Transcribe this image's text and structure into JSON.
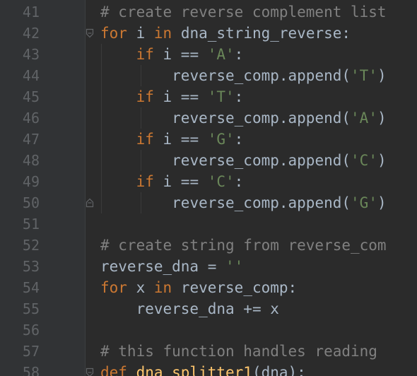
{
  "editor": {
    "colors": {
      "background": "#2b2b2b",
      "gutter": "#313335",
      "line_number": "#606366",
      "default_text": "#a9b7c6",
      "keyword": "#cc7832",
      "string": "#6a8759",
      "comment": "#808080"
    },
    "lines": [
      {
        "number": "41",
        "indent": "",
        "tokens": [
          {
            "t": "# create reverse complement list",
            "c": "comment"
          }
        ]
      },
      {
        "number": "42",
        "indent": "",
        "tokens": [
          {
            "t": "for",
            "c": "kw"
          },
          {
            "t": " i ",
            "c": "id"
          },
          {
            "t": "in",
            "c": "kw"
          },
          {
            "t": " dna_string_reverse:",
            "c": "id"
          }
        ]
      },
      {
        "number": "43",
        "indent": "    ",
        "tokens": [
          {
            "t": "if",
            "c": "kw"
          },
          {
            "t": " i == ",
            "c": "id"
          },
          {
            "t": "'A'",
            "c": "str"
          },
          {
            "t": ":",
            "c": "id"
          }
        ]
      },
      {
        "number": "44",
        "indent": "        ",
        "tokens": [
          {
            "t": "reverse_comp.append(",
            "c": "id"
          },
          {
            "t": "'T'",
            "c": "str"
          },
          {
            "t": ")",
            "c": "id"
          }
        ]
      },
      {
        "number": "45",
        "indent": "    ",
        "tokens": [
          {
            "t": "if",
            "c": "kw"
          },
          {
            "t": " i == ",
            "c": "id"
          },
          {
            "t": "'T'",
            "c": "str"
          },
          {
            "t": ":",
            "c": "id"
          }
        ]
      },
      {
        "number": "46",
        "indent": "        ",
        "tokens": [
          {
            "t": "reverse_comp.append(",
            "c": "id"
          },
          {
            "t": "'A'",
            "c": "str"
          },
          {
            "t": ")",
            "c": "id"
          }
        ]
      },
      {
        "number": "47",
        "indent": "    ",
        "tokens": [
          {
            "t": "if",
            "c": "kw"
          },
          {
            "t": " i == ",
            "c": "id"
          },
          {
            "t": "'G'",
            "c": "str"
          },
          {
            "t": ":",
            "c": "id"
          }
        ]
      },
      {
        "number": "48",
        "indent": "        ",
        "tokens": [
          {
            "t": "reverse_comp.append(",
            "c": "id"
          },
          {
            "t": "'C'",
            "c": "str"
          },
          {
            "t": ")",
            "c": "id"
          }
        ]
      },
      {
        "number": "49",
        "indent": "    ",
        "tokens": [
          {
            "t": "if",
            "c": "kw"
          },
          {
            "t": " i == ",
            "c": "id"
          },
          {
            "t": "'C'",
            "c": "str"
          },
          {
            "t": ":",
            "c": "id"
          }
        ]
      },
      {
        "number": "50",
        "indent": "        ",
        "tokens": [
          {
            "t": "reverse_comp.append(",
            "c": "id"
          },
          {
            "t": "'G'",
            "c": "str"
          },
          {
            "t": ")",
            "c": "id"
          }
        ]
      },
      {
        "number": "51",
        "indent": "",
        "tokens": []
      },
      {
        "number": "52",
        "indent": "",
        "tokens": [
          {
            "t": "# create string from reverse_com",
            "c": "comment"
          }
        ]
      },
      {
        "number": "53",
        "indent": "",
        "tokens": [
          {
            "t": "reverse_dna = ",
            "c": "id"
          },
          {
            "t": "''",
            "c": "str"
          }
        ]
      },
      {
        "number": "54",
        "indent": "",
        "tokens": [
          {
            "t": "for",
            "c": "kw"
          },
          {
            "t": " x ",
            "c": "id"
          },
          {
            "t": "in",
            "c": "kw"
          },
          {
            "t": " reverse_comp:",
            "c": "id"
          }
        ]
      },
      {
        "number": "55",
        "indent": "    ",
        "tokens": [
          {
            "t": "reverse_dna += x",
            "c": "id"
          }
        ]
      },
      {
        "number": "56",
        "indent": "",
        "tokens": []
      },
      {
        "number": "57",
        "indent": "",
        "tokens": [
          {
            "t": "# this function handles reading",
            "c": "comment"
          }
        ]
      },
      {
        "number": "58",
        "indent": "",
        "tokens": [
          {
            "t": "def",
            "c": "kw"
          },
          {
            "t": " ",
            "c": "id"
          },
          {
            "t": "dna_splitter1",
            "c": "def"
          },
          {
            "t": "(dna):",
            "c": "id"
          }
        ]
      }
    ],
    "fold_markers": [
      {
        "line": "42",
        "icon": "fold-open-icon"
      },
      {
        "line": "50",
        "icon": "fold-close-icon"
      },
      {
        "line": "58",
        "icon": "fold-open-icon"
      }
    ]
  }
}
